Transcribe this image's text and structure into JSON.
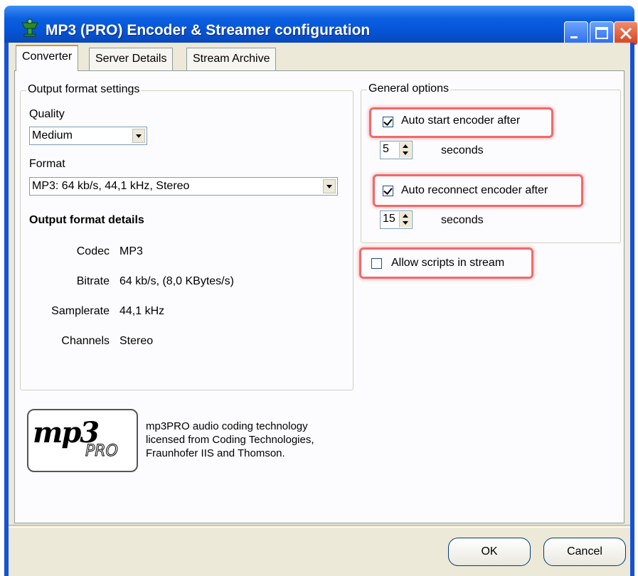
{
  "window": {
    "title": "MP3 (PRO) Encoder & Streamer configuration"
  },
  "tabs": [
    {
      "label": "Converter",
      "active": true
    },
    {
      "label": "Server Details",
      "active": false
    },
    {
      "label": "Stream Archive",
      "active": false
    }
  ],
  "output_format": {
    "group_title": "Output format settings",
    "quality_label": "Quality",
    "quality_value": "Medium",
    "format_label": "Format",
    "format_value": "MP3: 64 kb/s, 44,1 kHz, Stereo",
    "details_title": "Output format details",
    "details": [
      {
        "label": "Codec",
        "value": "MP3"
      },
      {
        "label": "Bitrate",
        "value": "64 kb/s, (8,0 KBytes/s)"
      },
      {
        "label": "Samplerate",
        "value": "44,1 kHz"
      },
      {
        "label": "Channels",
        "value": "Stereo"
      }
    ]
  },
  "general_options": {
    "group_title": "General options",
    "auto_start": {
      "label": "Auto start encoder after",
      "checked": true,
      "value": "5",
      "unit": "seconds"
    },
    "auto_reconnect": {
      "label": "Auto reconnect encoder after",
      "checked": true,
      "value": "15",
      "unit": "seconds"
    },
    "allow_scripts": {
      "label": "Allow scripts in stream",
      "checked": false
    }
  },
  "logo": {
    "mark": "mp3",
    "sub": "PRO",
    "note": [
      "mp3PRO audio coding technology",
      "licensed from Coding Technologies,",
      "Fraunhofer IIS and Thomson."
    ]
  },
  "buttons": {
    "ok": "OK",
    "cancel": "Cancel"
  },
  "colors": {
    "titlebar": "#0553d6",
    "highlight": "#f06a6a"
  }
}
